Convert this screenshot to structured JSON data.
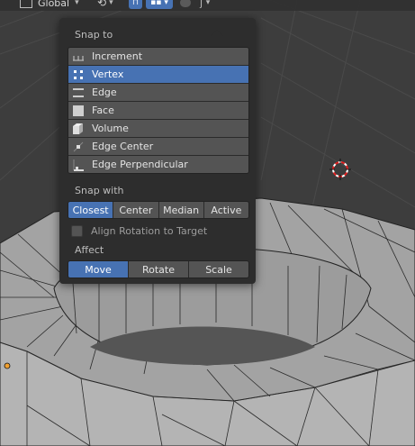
{
  "header": {
    "orientation_label": "Global",
    "snap_toggle_active": true
  },
  "popover": {
    "snap_to_title": "Snap to",
    "snap_to_items": [
      {
        "label": "Increment",
        "icon": "increment-icon",
        "active": false
      },
      {
        "label": "Vertex",
        "icon": "vertex-icon",
        "active": true
      },
      {
        "label": "Edge",
        "icon": "edge-icon",
        "active": false
      },
      {
        "label": "Face",
        "icon": "face-icon",
        "active": false
      },
      {
        "label": "Volume",
        "icon": "volume-icon",
        "active": false
      },
      {
        "label": "Edge Center",
        "icon": "edge-center-icon",
        "active": false
      },
      {
        "label": "Edge Perpendicular",
        "icon": "edge-perpendicular-icon",
        "active": false
      }
    ],
    "snap_with_title": "Snap with",
    "snap_with_options": [
      {
        "label": "Closest",
        "active": true
      },
      {
        "label": "Center",
        "active": false
      },
      {
        "label": "Median",
        "active": false
      },
      {
        "label": "Active",
        "active": false
      }
    ],
    "align_rotation_label": "Align Rotation to Target",
    "align_rotation_checked": false,
    "affect_title": "Affect",
    "affect_options": [
      {
        "label": "Move",
        "active": true
      },
      {
        "label": "Rotate",
        "active": false
      },
      {
        "label": "Scale",
        "active": false
      }
    ]
  },
  "colors": {
    "accent": "#4772b3",
    "popover_bg": "#2d2d2d",
    "item_bg": "#545454",
    "mesh_face": "#a9a9a9",
    "viewport_bg": "#3d3d3d"
  }
}
